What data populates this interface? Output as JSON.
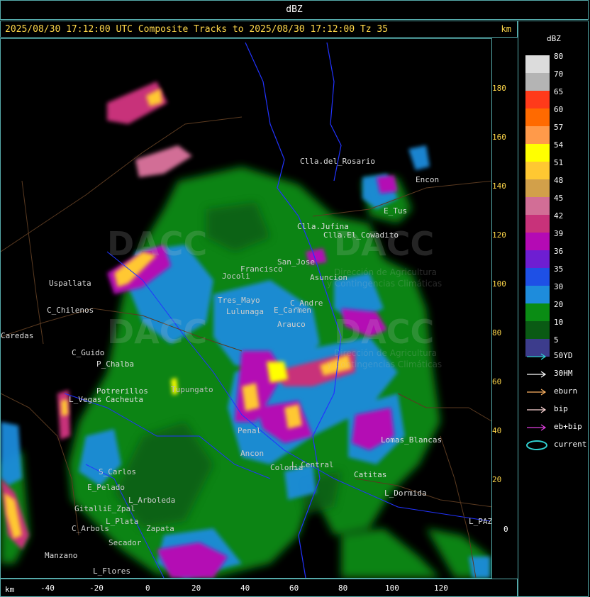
{
  "window": {
    "title": "dBZ"
  },
  "header": {
    "text": "2025/08/30 17:12:00 UTC Composite Tracks to 2025/08/30 17:12:00 Tz 35",
    "unit": "km"
  },
  "yaxis": {
    "ticks": [
      "180",
      "160",
      "140",
      "120",
      "100",
      "80",
      "60",
      "40",
      "20",
      "0"
    ]
  },
  "xaxis": {
    "unit": "km",
    "ticks": [
      "-40",
      "-20",
      "0",
      "20",
      "40",
      "60",
      "80",
      "100",
      "120"
    ]
  },
  "legend": {
    "title": "dBZ",
    "levels": [
      {
        "label": "80",
        "color": "#dcdcdc"
      },
      {
        "label": "70",
        "color": "#b4b4b4"
      },
      {
        "label": "65",
        "color": "#ff3a1a"
      },
      {
        "label": "60",
        "color": "#ff6a00"
      },
      {
        "label": "57",
        "color": "#ff9a4a"
      },
      {
        "label": "54",
        "color": "#ffff00"
      },
      {
        "label": "51",
        "color": "#ffc832"
      },
      {
        "label": "48",
        "color": "#d2a04a"
      },
      {
        "label": "45",
        "color": "#d26e96"
      },
      {
        "label": "42",
        "color": "#c8327a"
      },
      {
        "label": "39",
        "color": "#b40ab4"
      },
      {
        "label": "36",
        "color": "#6e1ed2"
      },
      {
        "label": "35",
        "color": "#1e50e6"
      },
      {
        "label": "30",
        "color": "#1e8cdc"
      },
      {
        "label": "20",
        "color": "#0a8c14"
      },
      {
        "label": "10",
        "color": "#0a5a14"
      },
      {
        "label": "5",
        "color": "#3c3c8c"
      }
    ]
  },
  "tracks": [
    {
      "label": "50YD",
      "color": "#30d0d0"
    },
    {
      "label": "30HM",
      "color": "#ffffff"
    },
    {
      "label": "eburn",
      "color": "#ffb464"
    },
    {
      "label": "bip",
      "color": "#ffd8d8"
    },
    {
      "label": "eb+bip",
      "color": "#e040e0"
    },
    {
      "label": "current",
      "color": "#30d0d0"
    }
  ],
  "watermark": {
    "logo": "DACC",
    "line1": "Dirección de Agricultura",
    "line2": "y Contingencias Climáticas"
  },
  "places": [
    {
      "name": "Clla.del_Rosario"
    },
    {
      "name": "Encon"
    },
    {
      "name": "E_Tus"
    },
    {
      "name": "Clla.Jufina"
    },
    {
      "name": "Clla.El_Cowadito"
    },
    {
      "name": "Jocoli"
    },
    {
      "name": "Francisco"
    },
    {
      "name": "San_Jose"
    },
    {
      "name": "Asuncion"
    },
    {
      "name": "Uspallata"
    },
    {
      "name": "C_Chilenos"
    },
    {
      "name": "Tres_Mayo"
    },
    {
      "name": "Lulunaga"
    },
    {
      "name": "E_Carmen"
    },
    {
      "name": "C_Andre"
    },
    {
      "name": "Arauco"
    },
    {
      "name": "Caredas"
    },
    {
      "name": "C_Guido"
    },
    {
      "name": "P_Chalba"
    },
    {
      "name": "Potrerillos"
    },
    {
      "name": "L_Vegas"
    },
    {
      "name": "Cacheuta"
    },
    {
      "name": "Tupungato"
    },
    {
      "name": "Penal"
    },
    {
      "name": "Ancon"
    },
    {
      "name": "L_Central"
    },
    {
      "name": "Colonia"
    },
    {
      "name": "Lomas_Blancas"
    },
    {
      "name": "Catitas"
    },
    {
      "name": "L_Dormida"
    },
    {
      "name": "L_PAZ"
    },
    {
      "name": "S_Carlos"
    },
    {
      "name": "E_Pelado"
    },
    {
      "name": "L_Arboleda"
    },
    {
      "name": "Gitalli"
    },
    {
      "name": "E_Zpal"
    },
    {
      "name": "L_Plata"
    },
    {
      "name": "Zapata"
    },
    {
      "name": "C_Arbols"
    },
    {
      "name": "Secador"
    },
    {
      "name": "Manzano"
    },
    {
      "name": "L_Flores"
    }
  ]
}
